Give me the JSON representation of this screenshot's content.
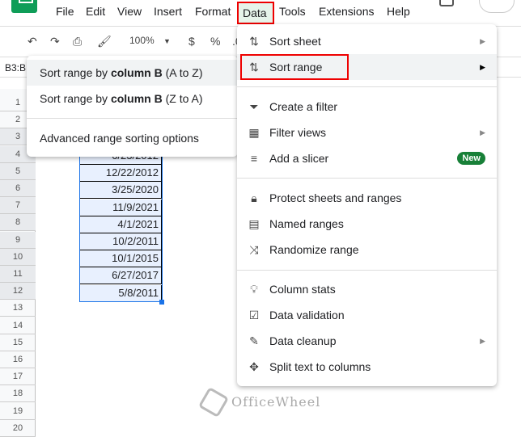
{
  "menubar": {
    "items": [
      "File",
      "Edit",
      "View",
      "Insert",
      "Format",
      "Data",
      "Tools",
      "Extensions",
      "Help"
    ]
  },
  "toolbar": {
    "zoom": "100%",
    "currency": "$",
    "percent": "%",
    "decimal": ".0"
  },
  "namebox": "B3:B",
  "rows": [
    "1",
    "2",
    "3",
    "4",
    "5",
    "6",
    "7",
    "8",
    "9",
    "10",
    "11",
    "12",
    "13",
    "14",
    "15",
    "16",
    "17",
    "18",
    "19",
    "20"
  ],
  "cells": [
    "6/23/2012",
    "12/22/2012",
    "3/25/2020",
    "11/9/2021",
    "4/1/2021",
    "10/2/2011",
    "10/1/2015",
    "6/27/2017",
    "5/8/2011"
  ],
  "data_menu": {
    "sort_sheet": "Sort sheet",
    "sort_range": "Sort range",
    "create_filter": "Create a filter",
    "filter_views": "Filter views",
    "add_slicer": "Add a slicer",
    "new_badge": "New",
    "protect": "Protect sheets and ranges",
    "named_ranges": "Named ranges",
    "randomize": "Randomize range",
    "column_stats": "Column stats",
    "data_validation": "Data validation",
    "data_cleanup": "Data cleanup",
    "split_text": "Split text to columns"
  },
  "submenu": {
    "az_prefix": "Sort range by ",
    "az_bold": "column B",
    "az_suffix": " (A to Z)",
    "za_prefix": "Sort range by ",
    "za_bold": "column B",
    "za_suffix": " (Z to A)",
    "advanced": "Advanced range sorting options"
  },
  "watermark": "OfficeWheel",
  "colors": {
    "highlight": "#ee0000",
    "selection": "#1a73e8",
    "badge": "#188038"
  }
}
